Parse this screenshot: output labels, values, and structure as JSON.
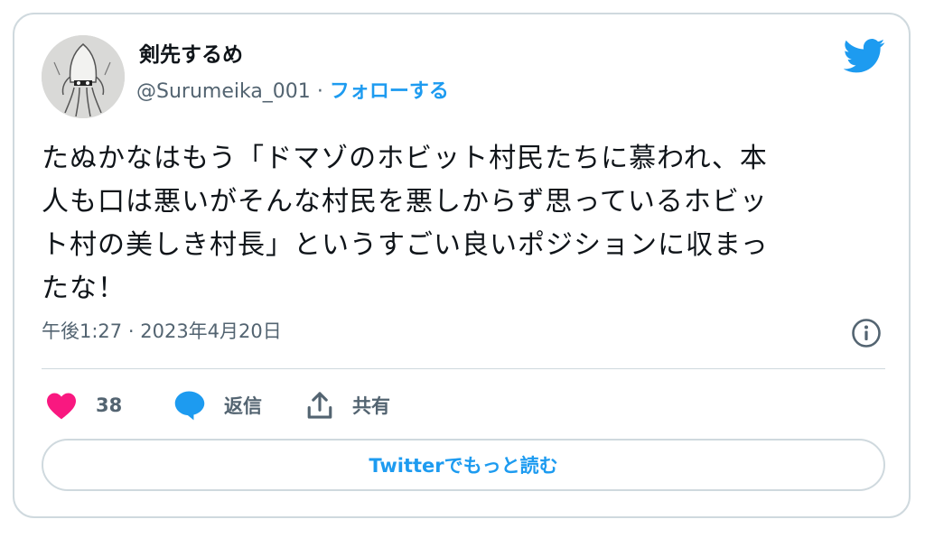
{
  "user": {
    "display_name": "剣先するめ",
    "handle": "@Surumeika_001",
    "separator": "·",
    "follow_label": "フォローする"
  },
  "tweet": {
    "lines": [
      "たぬかなはもう「ドマゾのホビット村民たちに慕われ、本",
      "人も口は悪いがそんな村民を悪しからず思っているホビッ",
      "ト村の美しき村長」というすごい良いポジションに収まっ",
      "たな！"
    ],
    "time": "午後1:27",
    "separator": "·",
    "date": "2023年4月20日"
  },
  "actions": {
    "like_count": "38",
    "reply_label": "返信",
    "share_label": "共有"
  },
  "read_more_label": "Twitterでもっと読む",
  "colors": {
    "brand_blue": "#1d9bf0",
    "like_pink": "#f91880",
    "text_primary": "#0f1419",
    "text_secondary": "#536471",
    "border": "#cfd9de"
  },
  "icons": [
    "twitter-bird-icon",
    "info-icon",
    "heart-icon",
    "reply-bubble-icon",
    "share-icon"
  ]
}
